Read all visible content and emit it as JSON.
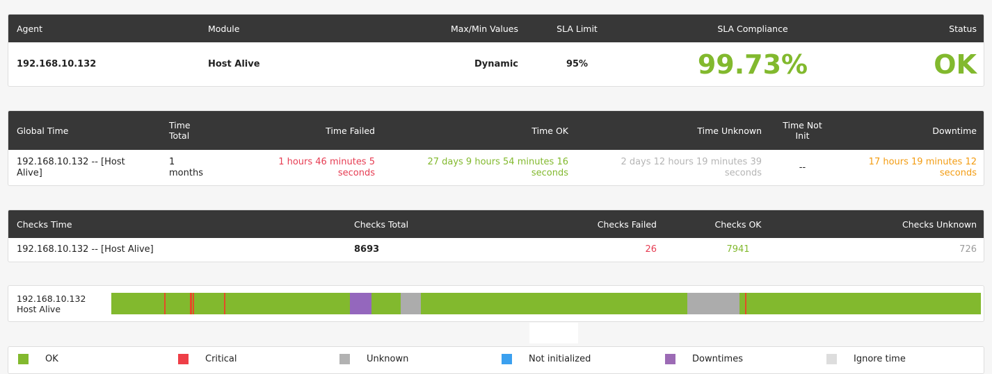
{
  "summary": {
    "headers": [
      "Agent",
      "Module",
      "Max/Min Values",
      "SLA Limit",
      "SLA Compliance",
      "Status"
    ],
    "agent": "192.168.10.132",
    "module": "Host Alive",
    "maxmin": "Dynamic",
    "sla_limit": "95%",
    "sla_compliance": "99.73%",
    "status": "OK"
  },
  "times": {
    "headers": [
      "Global Time",
      "Time Total",
      "Time Failed",
      "Time OK",
      "Time Unknown",
      "Time Not Init",
      "Downtime"
    ],
    "global": "192.168.10.132 -- [Host Alive]",
    "total": "1 months",
    "failed": "1 hours 46 minutes 5 seconds",
    "ok": "27 days 9 hours 54 minutes 16 seconds",
    "unknown": "2 days 12 hours 19 minutes 39 seconds",
    "not_init": "--",
    "downtime": "17 hours 19 minutes 12 seconds"
  },
  "checks": {
    "headers": [
      "Checks Time",
      "Checks Total",
      "Checks Failed",
      "Checks OK",
      "Checks Unknown"
    ],
    "name": "192.168.10.132 -- [Host Alive]",
    "total": "8693",
    "failed": "26",
    "ok": "7941",
    "unknown": "726"
  },
  "bar": {
    "agent": "192.168.10.132",
    "module": "Host Alive",
    "segments": [
      {
        "state": "critical",
        "start": 0.0605,
        "end": 0.0625
      },
      {
        "state": "critical",
        "start": 0.0905,
        "end": 0.0925
      },
      {
        "state": "critical",
        "start": 0.0935,
        "end": 0.095
      },
      {
        "state": "critical",
        "start": 0.1295,
        "end": 0.1315
      },
      {
        "state": "downtime",
        "start": 0.2745,
        "end": 0.299
      },
      {
        "state": "unknown",
        "start": 0.333,
        "end": 0.356
      },
      {
        "state": "unknown",
        "start": 0.662,
        "end": 0.722
      },
      {
        "state": "critical",
        "start": 0.7285,
        "end": 0.7305
      }
    ]
  },
  "legend": [
    {
      "label": "OK",
      "color": "#82b92e"
    },
    {
      "label": "Critical",
      "color": "#ee3f47"
    },
    {
      "label": "Unknown",
      "color": "#b2b2b2"
    },
    {
      "label": "Not initialized",
      "color": "#3ba0ef"
    },
    {
      "label": "Downtimes",
      "color": "#9c6bb5"
    },
    {
      "label": "Ignore time",
      "color": "#dddddd"
    }
  ],
  "colors": {
    "ok": "#82b92e",
    "critical": "#e44b27",
    "unknown": "#acacac",
    "downtime": "#9467bd"
  }
}
